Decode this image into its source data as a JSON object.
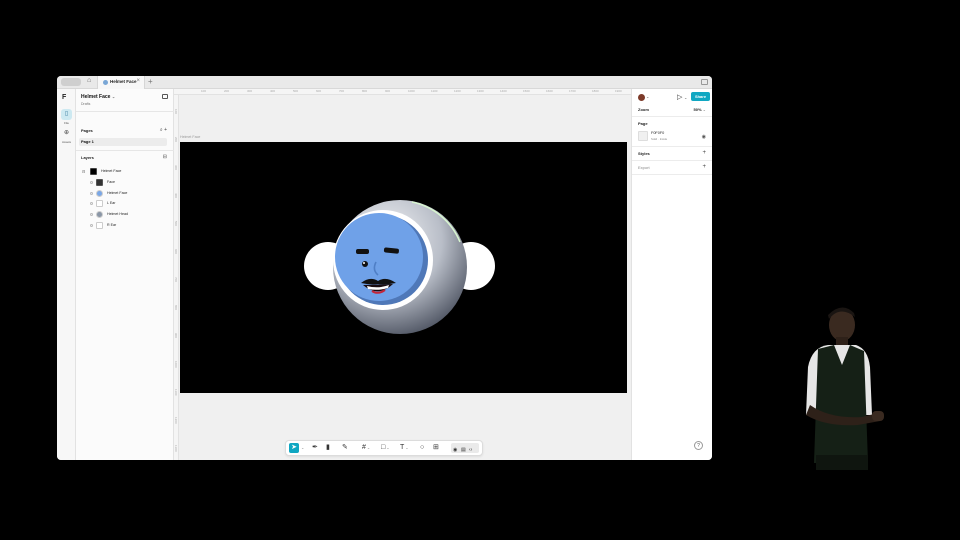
{
  "titlebar": {
    "tab_title": "Helmet Face"
  },
  "rail": {
    "items": [
      {
        "label": "File"
      },
      {
        "label": "Assets"
      }
    ]
  },
  "left_panel": {
    "file_name": "Helmet Face",
    "file_subtitle": "Drafts",
    "pages_heading": "Pages",
    "pages": [
      {
        "name": "Page 1"
      }
    ],
    "layers_heading": "Layers",
    "layers": [
      {
        "name": "Helmet Face",
        "thumb": "board-thumb"
      },
      {
        "name": "Face",
        "thumb": "face-thumb"
      },
      {
        "name": "Helmet Face",
        "thumb": "circle-thumb"
      },
      {
        "name": "L Ear",
        "thumb": "blank-thumb"
      },
      {
        "name": "Helmet Head",
        "thumb": "circle-thumb"
      },
      {
        "name": "R Ear",
        "thumb": "blank-thumb"
      }
    ]
  },
  "ruler": {
    "top_ticks": [
      "100",
      "200",
      "300",
      "400",
      "500",
      "600",
      "700",
      "800",
      "900",
      "1000",
      "1100",
      "1200",
      "1300",
      "1400",
      "1500",
      "1600",
      "1700",
      "1800",
      "1900"
    ],
    "left_ticks": [
      "100",
      "200",
      "300",
      "400",
      "500",
      "600",
      "700",
      "800",
      "900",
      "1000",
      "1100",
      "1200",
      "1300"
    ]
  },
  "canvas": {
    "frame_label": "Helmet Face",
    "frame_color": "#000000"
  },
  "right_panel": {
    "share_label": "Share",
    "zoom_label": "Zoom",
    "zoom_value": "50%",
    "page_heading": "Page",
    "page_color_hex": "F0F0F0",
    "page_color_sub": "Solid · Inside",
    "styles_heading": "Styles",
    "export_label": "Export",
    "help_label": "?"
  },
  "colors": {
    "accent": "#10a7c2",
    "face_blue": "#6fa1e8",
    "canvas_bg": "#f0f0f0"
  }
}
